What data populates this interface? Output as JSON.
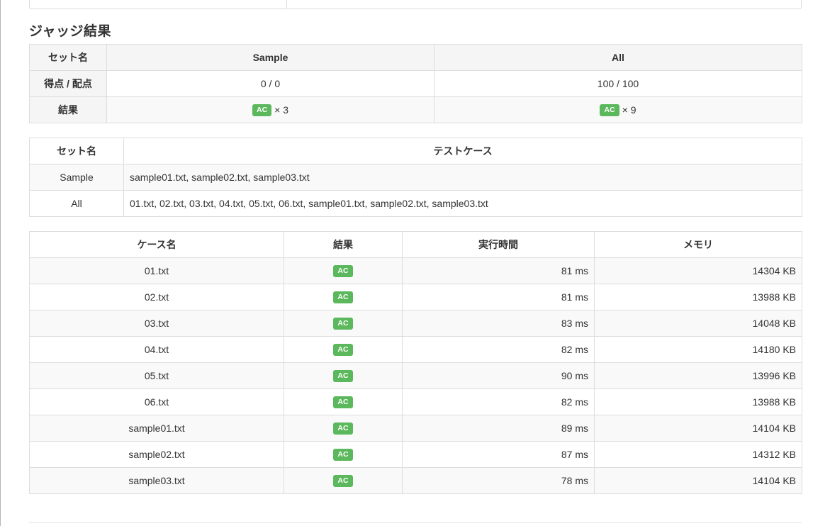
{
  "judge": {
    "title": "ジャッジ結果"
  },
  "summary": {
    "set_name_header": "セット名",
    "score_header": "得点 / 配点",
    "result_header": "結果",
    "sets": [
      {
        "name": "Sample",
        "score": "0 / 0",
        "status": "AC",
        "count": "× 3"
      },
      {
        "name": "All",
        "score": "100 / 100",
        "status": "AC",
        "count": "× 9"
      }
    ]
  },
  "sets_table": {
    "set_name_header": "セット名",
    "testcases_header": "テストケース",
    "rows": [
      {
        "name": "Sample",
        "cases": "sample01.txt, sample02.txt, sample03.txt"
      },
      {
        "name": "All",
        "cases": "01.txt, 02.txt, 03.txt, 04.txt, 05.txt, 06.txt, sample01.txt, sample02.txt, sample03.txt"
      }
    ]
  },
  "cases_table": {
    "headers": {
      "case_name": "ケース名",
      "result": "結果",
      "exec_time": "実行時間",
      "memory": "メモリ"
    },
    "rows": [
      {
        "name": "01.txt",
        "status": "AC",
        "time": "81 ms",
        "memory": "14304 KB"
      },
      {
        "name": "02.txt",
        "status": "AC",
        "time": "81 ms",
        "memory": "13988 KB"
      },
      {
        "name": "03.txt",
        "status": "AC",
        "time": "83 ms",
        "memory": "14048 KB"
      },
      {
        "name": "04.txt",
        "status": "AC",
        "time": "82 ms",
        "memory": "14180 KB"
      },
      {
        "name": "05.txt",
        "status": "AC",
        "time": "90 ms",
        "memory": "13996 KB"
      },
      {
        "name": "06.txt",
        "status": "AC",
        "time": "82 ms",
        "memory": "13988 KB"
      },
      {
        "name": "sample01.txt",
        "status": "AC",
        "time": "89 ms",
        "memory": "14104 KB"
      },
      {
        "name": "sample02.txt",
        "status": "AC",
        "time": "87 ms",
        "memory": "14312 KB"
      },
      {
        "name": "sample03.txt",
        "status": "AC",
        "time": "78 ms",
        "memory": "14104 KB"
      }
    ]
  },
  "colors": {
    "ac_badge": "#5cb85c",
    "border": "#dddddd",
    "header_bg": "#f5f5f5",
    "stripe_bg": "#f9f9f9"
  }
}
